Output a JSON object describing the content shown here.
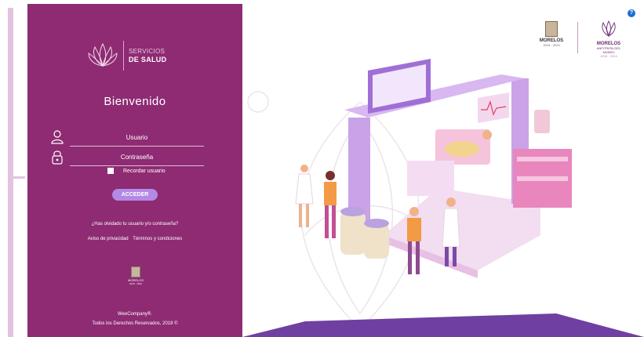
{
  "panel": {
    "logo": {
      "line1": "SERVICIOS",
      "line2": "DE SALUD"
    },
    "welcome": "Bienvenido",
    "username_placeholder": "Usuario",
    "password_placeholder": "Contraseña",
    "remember_label": "Recordar usuario",
    "login_button": "ACCEDER",
    "forgot_link": "¿Has olvidado tu usuario y/o contraseña?",
    "privacy_link": "Aviso de privacidad",
    "terms_link": "Términos y condiciones",
    "footer_logo": {
      "name": "MORELOS",
      "years": "2018 - 2024"
    },
    "company": "WeeCompany®.",
    "copyright": "Todos los Derechos Reservados, 2018 ©"
  },
  "header": {
    "brand_left": {
      "name": "MORELOS",
      "years": "2018 - 2024"
    },
    "brand_right": {
      "name": "MORELOS",
      "subtitle": "ANFITRIÓN DEL MUNDO",
      "years": "2018 - 2024"
    },
    "help_label": "?"
  },
  "colors": {
    "panel": "#8e2b73",
    "button": "#b28ae6",
    "accent_bar": "#e3c3e0",
    "help": "#1d6fd1"
  }
}
